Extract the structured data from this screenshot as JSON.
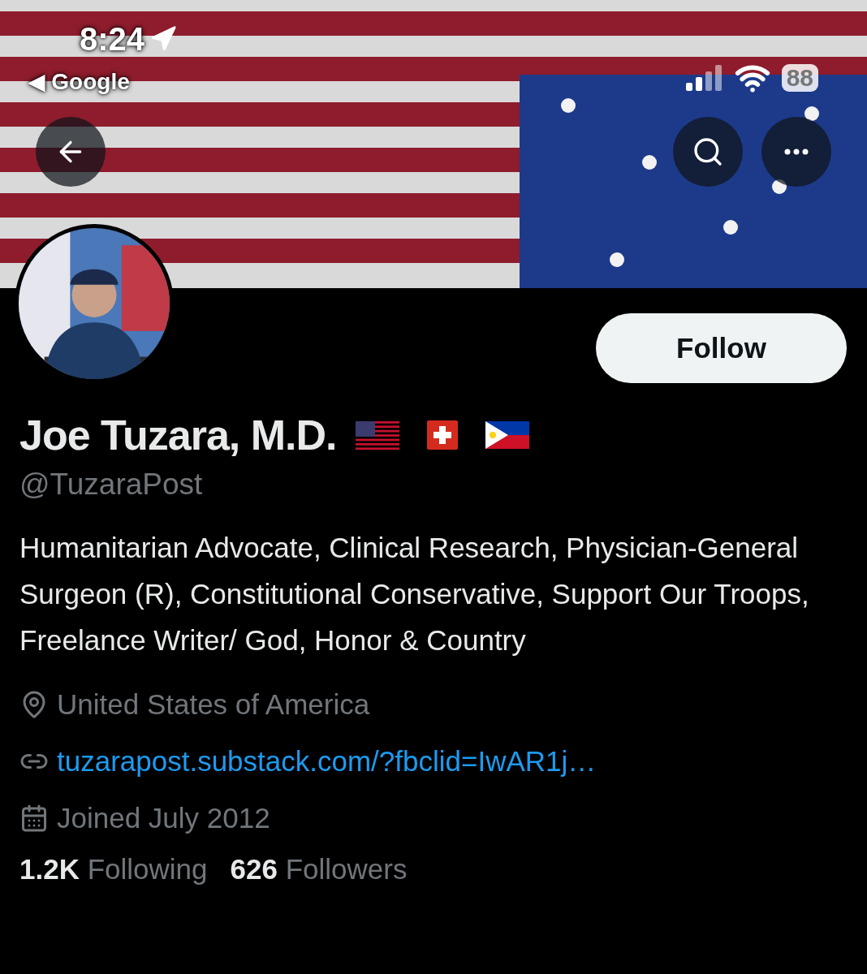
{
  "status_bar": {
    "time": "8:24",
    "back_app": "◀ Google",
    "battery": "88"
  },
  "follow_button": "Follow",
  "profile": {
    "name": "Joe Tuzara, M.D.",
    "flags": [
      {
        "kind": "us"
      },
      {
        "kind": "ch"
      },
      {
        "kind": "ph"
      }
    ],
    "handle": "@TuzaraPost",
    "bio": "Humanitarian Advocate, Clinical Research, Physician-General Surgeon (R), Constitutional Conservative, Support Our Troops, Freelance Writer/ God, Honor & Country",
    "location": "United States of America",
    "link": "tuzarapost.substack.com/?fbclid=IwAR1j…",
    "joined": "Joined July 2012"
  },
  "stats": [
    {
      "count": "1.2K",
      "label": "Following"
    },
    {
      "count": "626",
      "label": "Followers"
    }
  ]
}
